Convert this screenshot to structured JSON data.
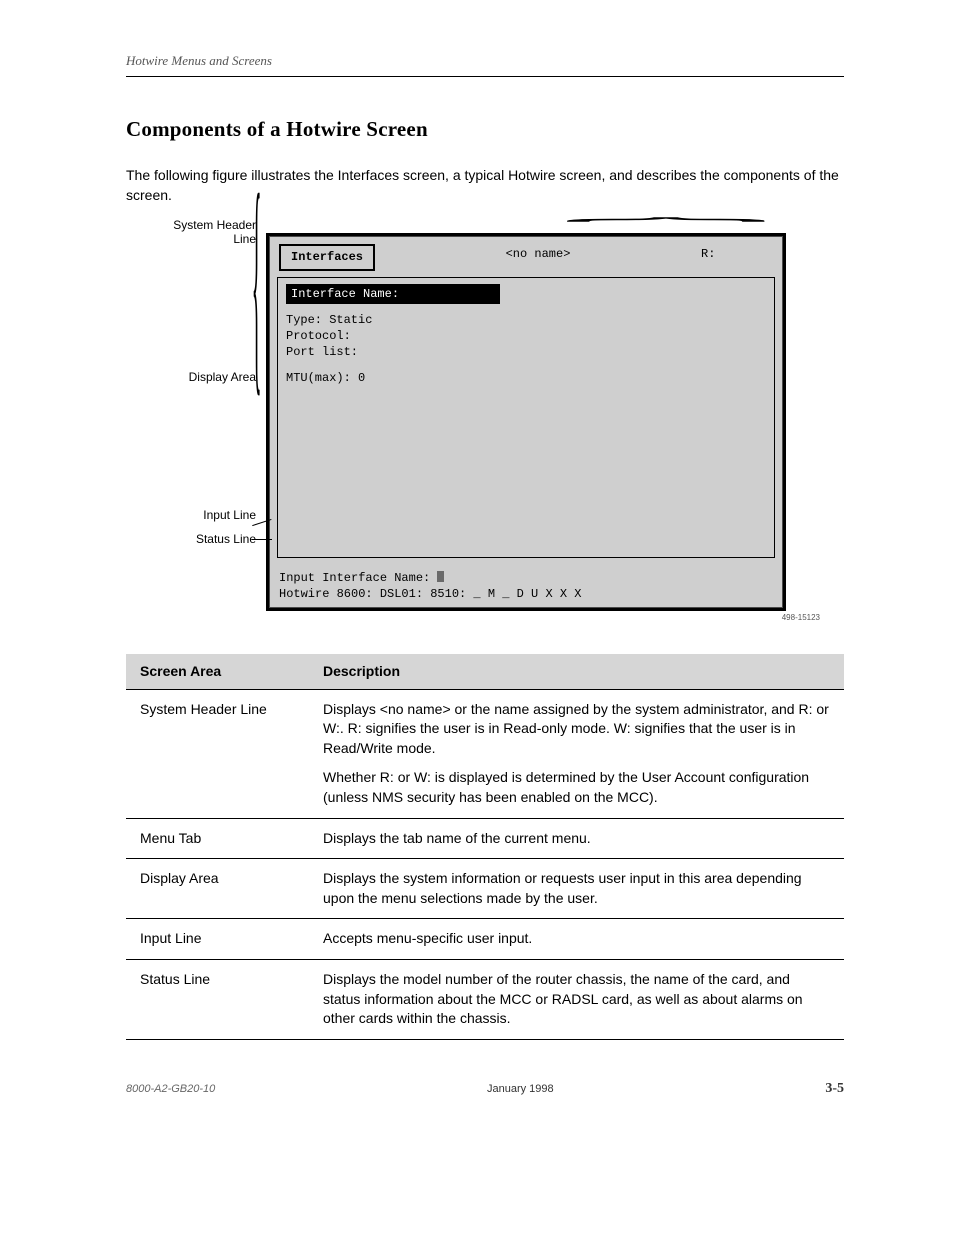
{
  "running_head": "Hotwire Menus and Screens",
  "subheading": "Components of a Hotwire Screen",
  "lead": "The following figure illustrates the Interfaces screen, a typical Hotwire screen, and describes the components of the screen.",
  "callouts": {
    "login": "System Header Line",
    "display": "Display Area",
    "input": "Input Line",
    "status": "Status Line"
  },
  "terminal": {
    "tab": "Interfaces",
    "header_center": "<no name>",
    "header_right": "R:",
    "iface_label": "Interface Name:",
    "type_line": "Type: Static",
    "protocol_line": "Protocol:",
    "portlist_line": "Port list:",
    "mtu_line": "MTU(max): 0",
    "prompt": "Input Interface Name:",
    "status": "Hotwire 8600: DSL01: 8510: _ M _ D  U X X X",
    "asset_id": "498-15123"
  },
  "table": {
    "headers": [
      "Screen Area",
      "Description"
    ],
    "rows": [
      {
        "k": "System Header Line",
        "paras": [
          "Displays <no name> or the name assigned by the system administrator, and R: or W:. R: signifies the user is in Read-only mode. W: signifies that the user is in Read/Write mode.",
          "Whether R: or W: is displayed is determined by the User Account configuration (unless NMS security has been enabled on the MCC)."
        ]
      },
      {
        "k": "Menu Tab",
        "paras": [
          "Displays the tab name of the current menu."
        ]
      },
      {
        "k": "Display Area",
        "paras": [
          "Displays the system information or requests user input in this area depending upon the menu selections made by the user."
        ]
      },
      {
        "k": "Input Line",
        "paras": [
          "Accepts menu-specific user input."
        ]
      },
      {
        "k": "Status Line",
        "paras": [
          "Displays the model number of the router chassis, the name of the card, and status information about the MCC or RADSL card, as well as about alarms on other cards within the chassis."
        ]
      }
    ]
  },
  "footer": {
    "docid": "8000-A2-GB20-10",
    "month": "January 1998",
    "page": "3-5"
  }
}
